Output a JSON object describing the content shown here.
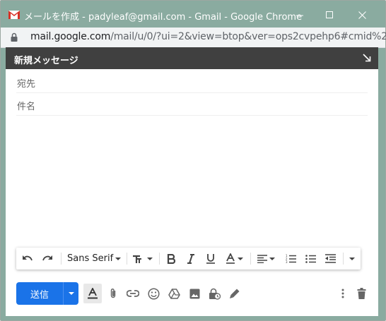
{
  "window": {
    "title": "メールを作成 - padyleaf@gmail.com - Gmail - Google Chrome",
    "minimize_icon": "minimize-icon",
    "maximize_icon": "maximize-icon",
    "close_icon": "close-icon"
  },
  "addressbar": {
    "host": "mail.google.com",
    "path": "/mail/u/0/?ui=2&view=btop&ver=ops2cvpehp6#cmid%2..."
  },
  "compose": {
    "title": "新規メッセージ",
    "to_label": "宛先",
    "subject_label": "件名",
    "to_value": "",
    "subject_value": "",
    "body": ""
  },
  "formatting": {
    "font": "Sans Serif",
    "icons": [
      "undo-icon",
      "redo-icon",
      "font-size-icon",
      "bold-icon",
      "italic-icon",
      "underline-icon",
      "text-color-icon",
      "align-icon",
      "numbered-list-icon",
      "bulleted-list-icon",
      "indent-less-icon",
      "more-formatting-icon"
    ]
  },
  "footer": {
    "send_label": "送信",
    "icons": [
      "formatting-toggle-icon",
      "attach-icon",
      "link-icon",
      "emoji-icon",
      "drive-icon",
      "photo-icon",
      "confidential-mode-icon",
      "signature-icon",
      "more-options-icon",
      "discard-icon"
    ]
  },
  "colors": {
    "titlebar": "#8aaba0",
    "compose_header": "#404040",
    "send_button": "#1a73e8"
  }
}
